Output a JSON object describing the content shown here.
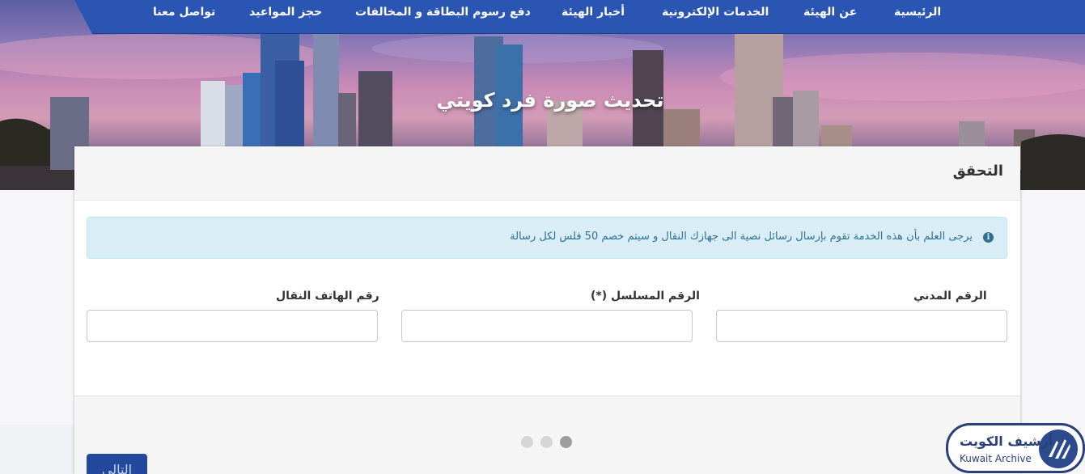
{
  "nav": {
    "items": [
      {
        "label": "الرئيسية"
      },
      {
        "label": "عن الهيئة"
      },
      {
        "label": "الخدمات الإلكترونية"
      },
      {
        "label": "أخبار الهيئة"
      },
      {
        "label": "دفع رسوم البطاقة و المخالفات"
      },
      {
        "label": "حجز المواعيد"
      },
      {
        "label": "تواصل معنا"
      }
    ]
  },
  "hero": {
    "title": "تحديث صورة فرد كويتي"
  },
  "card": {
    "title": "التحقق",
    "alert": {
      "icon": "info-circle-icon",
      "text": "يرجى العلم بأن هذه الخدمة تقوم بإرسال رسائل نصية الى جهازك النقال و سيتم خصم 50 فلس لكل رسالة"
    },
    "fields": [
      {
        "label": "الرقم المدني",
        "value": ""
      },
      {
        "label": "الرقم المسلسل (*)",
        "value": ""
      },
      {
        "label": "رقم الهاتف النقال",
        "value": ""
      }
    ],
    "steps": {
      "total": 3,
      "active": 1
    },
    "next_label": "التالي"
  },
  "watermark": {
    "arabic": "أرشيف الكويت",
    "english": "Kuwait Archive"
  },
  "colors": {
    "nav": "#2b55b2",
    "button": "#23499c",
    "alert_bg": "#d9edf7",
    "alert_text": "#31708f"
  }
}
